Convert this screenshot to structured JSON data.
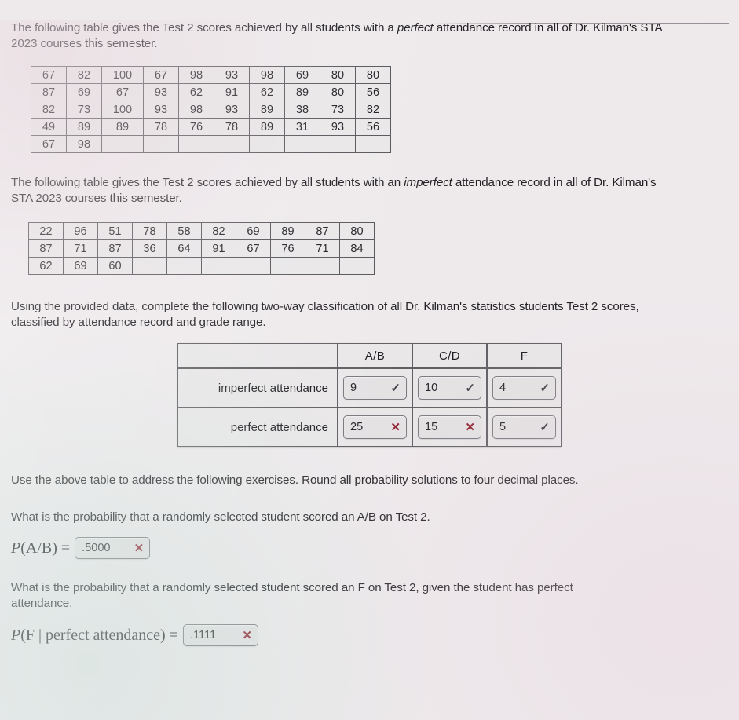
{
  "intro_perfect": {
    "text_before": "The following table gives the Test 2 scores achieved by all students with a ",
    "emphasis": "perfect",
    "text_after": " attendance record in all of Dr. Kilman's STA 2023 courses this semester."
  },
  "perfect_scores_table": {
    "rows": [
      [
        "67",
        "82",
        "100",
        "67",
        "98",
        "93",
        "98",
        "69",
        "80",
        "80"
      ],
      [
        "87",
        "69",
        "67",
        "93",
        "62",
        "91",
        "62",
        "89",
        "80",
        "56"
      ],
      [
        "82",
        "73",
        "100",
        "93",
        "98",
        "93",
        "89",
        "38",
        "73",
        "82"
      ],
      [
        "49",
        "89",
        "89",
        "78",
        "76",
        "78",
        "89",
        "31",
        "93",
        "56"
      ],
      [
        "67",
        "98",
        "",
        "",
        "",
        "",
        "",
        "",
        "",
        ""
      ]
    ]
  },
  "intro_imperfect": {
    "text_before": "The following table gives the Test 2 scores achieved by all students with an ",
    "emphasis": "imperfect",
    "text_after": " attendance record in all of Dr. Kilman's STA 2023 courses this semester."
  },
  "imperfect_scores_table": {
    "rows": [
      [
        "22",
        "96",
        "51",
        "78",
        "58",
        "82",
        "69",
        "89",
        "87",
        "80"
      ],
      [
        "87",
        "71",
        "87",
        "36",
        "64",
        "91",
        "67",
        "76",
        "71",
        "84"
      ],
      [
        "62",
        "69",
        "60",
        "",
        "",
        "",
        "",
        "",
        "",
        ""
      ]
    ]
  },
  "classification_instruction": "Using the provided data, complete the following two-way classification of all Dr. Kilman's statistics students Test 2 scores, classified by attendance record and grade range.",
  "classification_table": {
    "corner_label": "",
    "column_headers": [
      "A/B",
      "C/D",
      "F"
    ],
    "rows": [
      {
        "label": "imperfect attendance",
        "cells": [
          {
            "value": "9",
            "mark": "✓",
            "status": "correct"
          },
          {
            "value": "10",
            "mark": "✓",
            "status": "correct"
          },
          {
            "value": "4",
            "mark": "✓",
            "status": "correct"
          }
        ]
      },
      {
        "label": "perfect attendance",
        "cells": [
          {
            "value": "25",
            "mark": "✕",
            "status": "incorrect"
          },
          {
            "value": "15",
            "mark": "✕",
            "status": "incorrect"
          },
          {
            "value": "5",
            "mark": "✓",
            "status": "correct"
          }
        ]
      }
    ]
  },
  "exercises_instruction": "Use the above table to address the following exercises. Round all probability solutions to four decimal places.",
  "exercise_1": {
    "question": "What is the probability that a randomly selected student scored an A/B on Test 2.",
    "math_label_p": "P",
    "math_label_arg": "(A/B)",
    "equals": "=",
    "answer": ".5000",
    "mark": "✕",
    "status": "incorrect"
  },
  "exercise_2": {
    "question": "What is the probability that a randomly selected student scored an F on Test 2, given the student has perfect attendance.",
    "math_label_p": "P",
    "math_label_arg": "(F | perfect attendance)",
    "equals": "=",
    "answer": ".1111",
    "mark": "✕",
    "status": "incorrect"
  },
  "colors": {
    "page_background": "#eeeaec",
    "table_cell": "#e9e7e8",
    "table_border": "#57565c",
    "incorrect_mark": "#8f2230",
    "correct_mark": "#3b3a40",
    "text": "#232226"
  }
}
